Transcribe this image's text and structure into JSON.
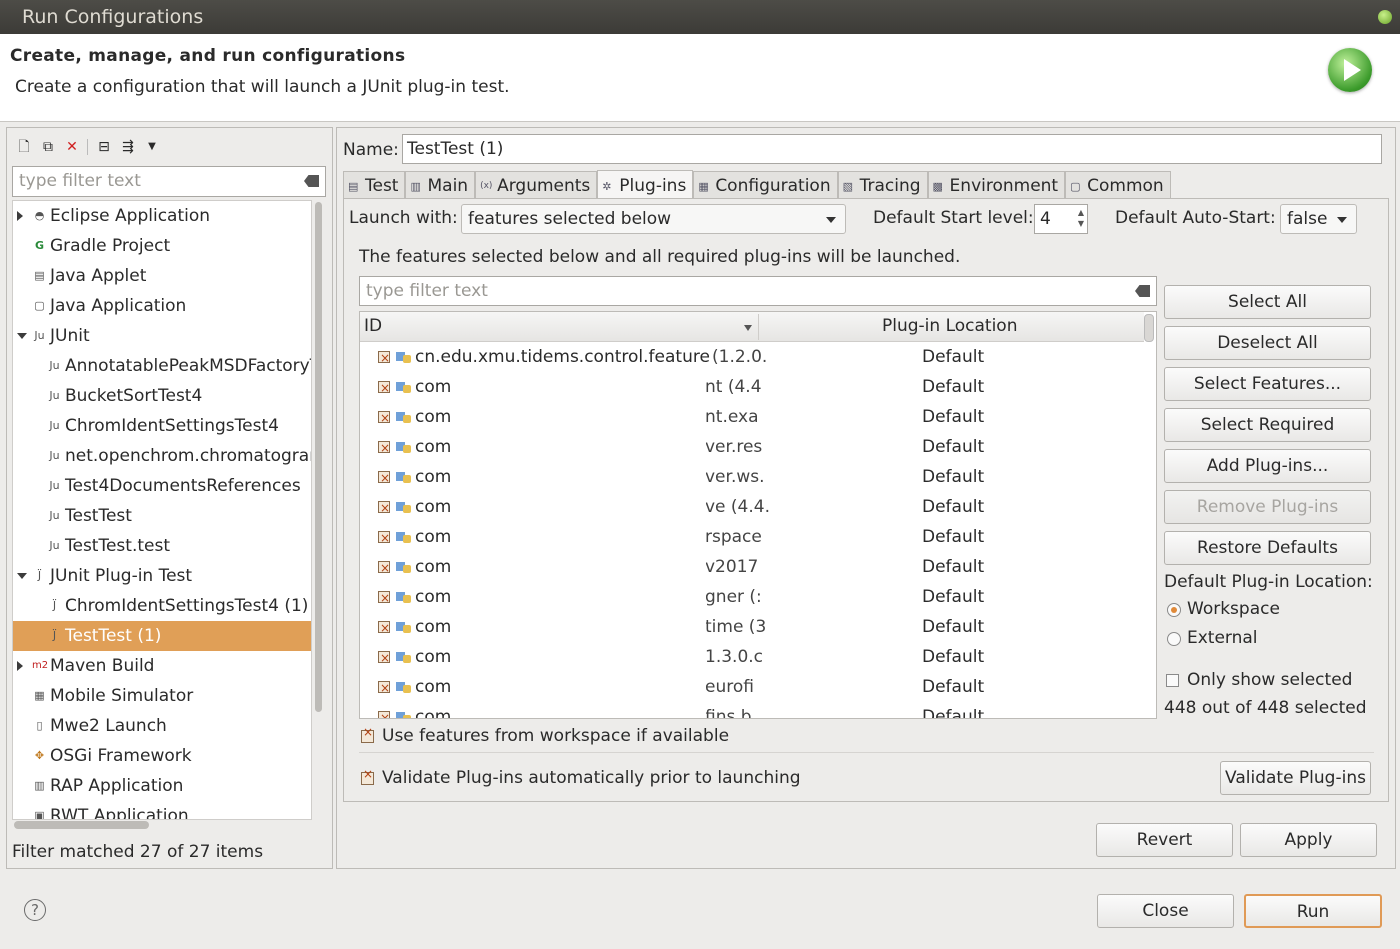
{
  "window": {
    "title": "Run Configurations"
  },
  "header": {
    "title": "Create, manage, and run configurations",
    "subtitle": "Create a configuration that will launch a JUnit plug-in test."
  },
  "left": {
    "filter_placeholder": "type filter text",
    "tree": [
      {
        "label": "Eclipse Application",
        "level": 0,
        "expander": "collapsed",
        "icon": "eclipse-icon"
      },
      {
        "label": "Gradle Project",
        "level": 0,
        "expander": "none",
        "icon": "gradle-icon"
      },
      {
        "label": "Java Applet",
        "level": 0,
        "expander": "none",
        "icon": "applet-icon"
      },
      {
        "label": "Java Application",
        "level": 0,
        "expander": "none",
        "icon": "java-app-icon"
      },
      {
        "label": "JUnit",
        "level": 0,
        "expander": "expanded",
        "icon": "junit-icon"
      },
      {
        "label": "AnnotatablePeakMSDFactoryT",
        "level": 1,
        "expander": "none",
        "icon": "junit-icon"
      },
      {
        "label": "BucketSortTest4",
        "level": 1,
        "expander": "none",
        "icon": "junit-icon"
      },
      {
        "label": "ChromIdentSettingsTest4",
        "level": 1,
        "expander": "none",
        "icon": "junit-icon"
      },
      {
        "label": "net.openchrom.chromatograr",
        "level": 1,
        "expander": "none",
        "icon": "junit-icon"
      },
      {
        "label": "Test4DocumentsReferences",
        "level": 1,
        "expander": "none",
        "icon": "junit-icon"
      },
      {
        "label": "TestTest",
        "level": 1,
        "expander": "none",
        "icon": "junit-icon"
      },
      {
        "label": "TestTest.test",
        "level": 1,
        "expander": "none",
        "icon": "junit-icon"
      },
      {
        "label": "JUnit Plug-in Test",
        "level": 0,
        "expander": "expanded",
        "icon": "junit-plugin-icon"
      },
      {
        "label": "ChromIdentSettingsTest4 (1)",
        "level": 1,
        "expander": "none",
        "icon": "junit-plugin-icon"
      },
      {
        "label": "TestTest (1)",
        "level": 1,
        "expander": "none",
        "icon": "junit-plugin-icon",
        "selected": true
      },
      {
        "label": "Maven Build",
        "level": 0,
        "expander": "collapsed",
        "icon": "maven-icon"
      },
      {
        "label": "Mobile Simulator",
        "level": 0,
        "expander": "none",
        "icon": "mobile-icon"
      },
      {
        "label": "Mwe2 Launch",
        "level": 0,
        "expander": "none",
        "icon": "mwe2-icon"
      },
      {
        "label": "OSGi Framework",
        "level": 0,
        "expander": "none",
        "icon": "osgi-icon"
      },
      {
        "label": "RAP Application",
        "level": 0,
        "expander": "none",
        "icon": "rap-icon"
      },
      {
        "label": "RWT Application",
        "level": 0,
        "expander": "none",
        "icon": "rwt-icon"
      }
    ],
    "status": "Filter matched 27 of 27 items"
  },
  "right": {
    "name_label": "Name:",
    "name_value": "TestTest (1)",
    "tabs": [
      {
        "label": "Test",
        "icon": "test-tab-icon"
      },
      {
        "label": "Main",
        "icon": "main-tab-icon"
      },
      {
        "label": "Arguments",
        "icon": "arguments-tab-icon"
      },
      {
        "label": "Plug-ins",
        "icon": "plugins-tab-icon",
        "active": true
      },
      {
        "label": "Configuration",
        "icon": "configuration-tab-icon"
      },
      {
        "label": "Tracing",
        "icon": "tracing-tab-icon"
      },
      {
        "label": "Environment",
        "icon": "environment-tab-icon"
      },
      {
        "label": "Common",
        "icon": "common-tab-icon"
      }
    ],
    "launch_with_label": "Launch with:",
    "launch_with_value": "features selected below",
    "start_level_label": "Default Start level:",
    "start_level_value": "4",
    "auto_start_label": "Default Auto-Start:",
    "auto_start_value": "false",
    "info": "The features selected below and all required plug-ins will be launched.",
    "filter_placeholder": "type filter text",
    "columns": {
      "id": "ID",
      "location": "Plug-in Location"
    },
    "rows": [
      {
        "id": "cn.edu.xmu.tidems.control.feature",
        "ver": "(1.2.0.",
        "loc": "Default"
      },
      {
        "id": "com",
        "ver": "nt (4.4",
        "loc": "Default"
      },
      {
        "id": "com",
        "ver": "nt.exa",
        "loc": "Default"
      },
      {
        "id": "com",
        "ver": "ver.res",
        "loc": "Default"
      },
      {
        "id": "com",
        "ver": "ver.ws.",
        "loc": "Default"
      },
      {
        "id": "com",
        "ver": "ve (4.4.",
        "loc": "Default"
      },
      {
        "id": "com",
        "ver": "rspace",
        "loc": "Default"
      },
      {
        "id": "com",
        "ver": "v2017",
        "loc": "Default"
      },
      {
        "id": "com",
        "ver": "gner (:",
        "loc": "Default"
      },
      {
        "id": "com",
        "ver": "time (3",
        "loc": "Default"
      },
      {
        "id": "com",
        "ver": "1.3.0.c",
        "loc": "Default"
      },
      {
        "id": "com",
        "ver": "eurofi",
        "loc": "Default"
      },
      {
        "id": "com",
        "ver": "fins.b",
        "loc": "Default"
      }
    ],
    "buttons": {
      "select_all": "Select All",
      "deselect_all": "Deselect All",
      "select_features": "Select Features...",
      "select_required": "Select Required",
      "add_plugins": "Add Plug-ins...",
      "remove_plugins": "Remove Plug-ins",
      "restore_defaults": "Restore Defaults",
      "validate": "Validate Plug-ins",
      "revert": "Revert",
      "apply": "Apply"
    },
    "location_label": "Default Plug-in Location:",
    "location_options": [
      "Workspace",
      "External"
    ],
    "location_selected": "Workspace",
    "only_show_selected": "Only show selected",
    "selected_count": "448 out of 448 selected",
    "use_workspace_features": "Use features from workspace if available",
    "validate_auto": "Validate Plug-ins automatically prior to launching"
  },
  "footer": {
    "close": "Close",
    "run": "Run"
  }
}
